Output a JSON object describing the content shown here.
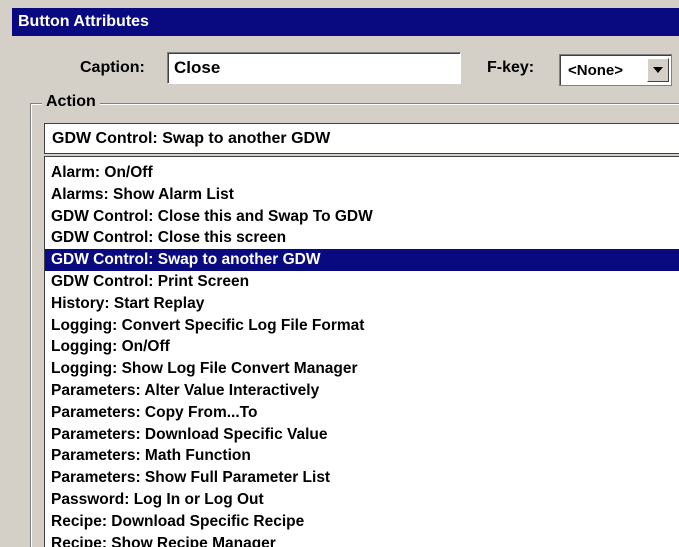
{
  "dialog": {
    "title": "Button Attributes",
    "caption_label": "Caption:",
    "caption_value": "Close",
    "fkey_label": "F-key:",
    "fkey_value": "<None>",
    "action_label": "Action",
    "action_selected": "GDW Control:  Swap to another GDW"
  },
  "action_options": [
    "Alarm: On/Off",
    "Alarms: Show Alarm List",
    "GDW Control:  Close this and Swap To GDW",
    "GDW Control:  Close this screen",
    "GDW Control:  Swap to another GDW",
    "GDW Control: Print Screen",
    "History: Start Replay",
    "Logging: Convert Specific Log File Format",
    "Logging: On/Off",
    "Logging: Show Log File Convert Manager",
    "Parameters: Alter Value Interactively",
    "Parameters: Copy From...To",
    "Parameters: Download Specific Value",
    "Parameters: Math Function",
    "Parameters: Show Full Parameter List",
    "Password: Log In or Log Out",
    "Recipe: Download Specific Recipe",
    "Recipe: Show Recipe Manager"
  ],
  "selected_index": 4,
  "colors": {
    "titlebar": "#0a0a80",
    "selection": "#0a0a80",
    "face": "#d4d0c8"
  }
}
